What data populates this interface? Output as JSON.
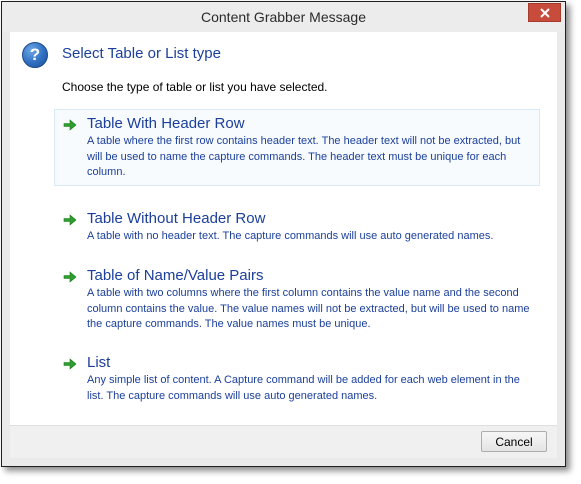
{
  "window": {
    "title": "Content Grabber Message"
  },
  "header": {
    "icon": "help-question-icon",
    "heading": "Select Table or List type",
    "instruction": "Choose the type of table or list you have selected."
  },
  "options": [
    {
      "title": "Table With Header Row",
      "description": "A table where the first row contains header text. The header text will not be extracted, but will be used to name the capture commands. The header text must be unique for each column.",
      "selected": true
    },
    {
      "title": "Table Without Header Row",
      "description": "A table with no header text. The capture commands will use auto generated names.",
      "selected": false
    },
    {
      "title": "Table of Name/Value Pairs",
      "description": "A table with two columns where the first column contains the value name and the second column contains the value. The value names will not be extracted, but will be used to name the capture commands. The value names must be unique.",
      "selected": false
    },
    {
      "title": "List",
      "description": "Any simple list of content. A Capture command will be added for each web element in the list. The capture commands will use auto generated names.",
      "selected": false
    }
  ],
  "footer": {
    "cancel_label": "Cancel"
  },
  "colors": {
    "link_text": "#1b3f9a",
    "close_button": "#c74c3c",
    "arrow_icon": "#2e9e2e"
  }
}
